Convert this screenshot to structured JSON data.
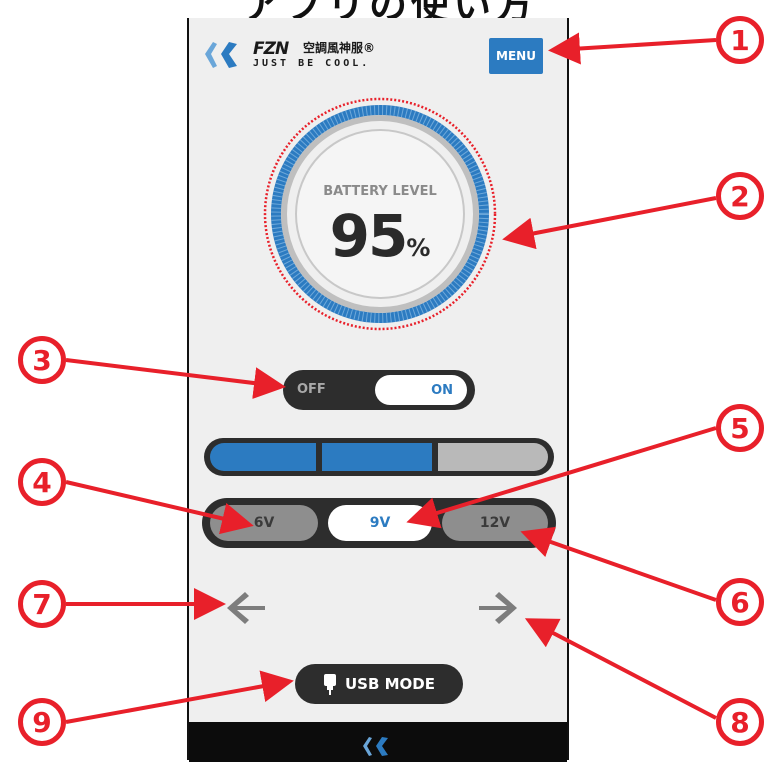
{
  "caption": "アプリの使い方",
  "header": {
    "brand": "FZN",
    "brand_jp": "空調風神服®",
    "tagline": "JUST BE COOL.",
    "menu_label": "MENU"
  },
  "battery": {
    "label": "BATTERY LEVEL",
    "value": "95",
    "unit": "%"
  },
  "power_toggle": {
    "off_label": "OFF",
    "on_label": "ON",
    "state": "on"
  },
  "level_bar": {
    "segments_total": 3,
    "segments_active": 2
  },
  "voltage": {
    "options": [
      "6V",
      "9V",
      "12V"
    ],
    "selected": "9V"
  },
  "usb_mode_label": "USB MODE",
  "callouts": [
    "1",
    "2",
    "3",
    "4",
    "5",
    "6",
    "7",
    "8",
    "9"
  ],
  "colors": {
    "accent": "#2c7bc1",
    "annotation": "#e8202a",
    "dark": "#2d2d2d",
    "panel": "#efefef"
  },
  "icons": [
    "logo-mark-icon",
    "arrow-left-icon",
    "arrow-right-icon",
    "usb-icon",
    "footer-logo-icon"
  ]
}
